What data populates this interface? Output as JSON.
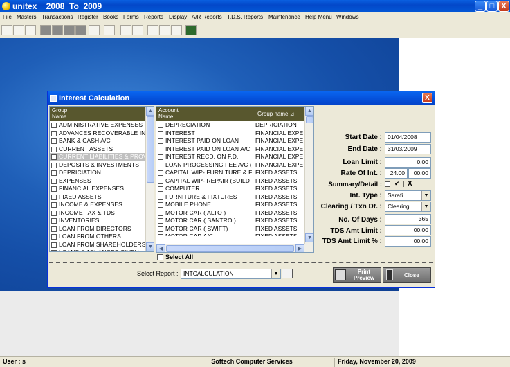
{
  "app": {
    "title": "unitex    2008  To  2009",
    "window_buttons": [
      "_",
      "□",
      "X"
    ]
  },
  "menu": [
    "File",
    "Masters",
    "Transactions",
    "Register",
    "Books",
    "Forms",
    "Reports",
    "Display",
    "A/R Reports",
    "T.D.S. Reports",
    "Maintenance",
    "Help Menu",
    "Windows"
  ],
  "dialog": {
    "title": "Interest Calculation",
    "close": "X",
    "group_grid": {
      "header": "Group\nName",
      "selected_index": 4,
      "rows": [
        "ADMINISTRATIVE EXPENSES",
        "ADVANCES RECOVERABLE IN",
        "BANK & CASH A/C",
        "CURRENT ASSETS",
        "CURRENT LIABILITIES & PROV",
        "DEPOSITS & INVESTMENTS",
        "DEPRICIATION",
        "EXPENSES",
        "FINANCIAL EXPENSES",
        "FIXED ASSETS",
        "INCOME & EXPENSES",
        "INCOME TAX & TDS",
        "INVENTORIES",
        "LOAN FROM DIRECTORS",
        "LOAN FROM OTHERS",
        "LOAN FROM SHAREHOLDERS",
        "LOANS & ADVANCES GIVEN"
      ]
    },
    "account_grid": {
      "header_account": "Account\nName",
      "header_group": "Group name",
      "rows": [
        {
          "account": "DEPRECIATION",
          "group": "DEPRICIATION"
        },
        {
          "account": "INTEREST",
          "group": "FINANCIAL EXPE"
        },
        {
          "account": "INTEREST  PAID ON LOAN",
          "group": "FINANCIAL EXPE"
        },
        {
          "account": "INTEREST PAID ON LOAN A/C",
          "group": "FINANCIAL EXPE"
        },
        {
          "account": "INTEREST RECD. ON F.D.",
          "group": "FINANCIAL EXPE"
        },
        {
          "account": "LOAN PROCESSING FEE A/C (",
          "group": "FINANCIAL EXPE"
        },
        {
          "account": "CAPITAL WIP- FURNITURE & FI",
          "group": "FIXED ASSETS"
        },
        {
          "account": "CAPITAL WIP- REPAIR (BUILD",
          "group": "FIXED ASSETS"
        },
        {
          "account": "COMPUTER",
          "group": "FIXED ASSETS"
        },
        {
          "account": "FURNITURE & FIXTURES",
          "group": "FIXED ASSETS"
        },
        {
          "account": "MOBILE PHONE",
          "group": "FIXED ASSETS"
        },
        {
          "account": "MOTOR CAR ( ALTO )",
          "group": "FIXED ASSETS"
        },
        {
          "account": "MOTOR CAR ( SANTRO )",
          "group": "FIXED ASSETS"
        },
        {
          "account": "MOTOR CAR ( SWIFT)",
          "group": "FIXED ASSETS"
        },
        {
          "account": "MOTOR CAR A/C",
          "group": "FIXED ASSETS"
        },
        {
          "account": "OFFICE EQUIPMENT",
          "group": "FIXED ASSETS"
        }
      ]
    },
    "select_all": "Select All",
    "form": {
      "start_date_label": "Start Date :",
      "start_date": "01/04/2008",
      "end_date_label": "End Date :",
      "end_date": "31/03/2009",
      "loan_limit_label": "Loan Limit :",
      "loan_limit": "0.00",
      "rate_label": "Rate Of Int. :",
      "rate1": "24.00",
      "rate2": "00.00",
      "summary_label": "Summary/Detail :",
      "summary_check": "✔",
      "summary_x": "X",
      "int_type_label": "Int. Type :",
      "int_type": "Sarafi",
      "clearing_label": "Clearing / Txn Dt. :",
      "clearing": "Clearing",
      "days_label": "No. Of Days :",
      "days": "365",
      "tds_limit_label": "TDS Amt Limit :",
      "tds_limit": "00.00",
      "tds_pct_label": "TDS Amt Limit % :",
      "tds_pct": "00.00"
    },
    "select_report_label": "Select Report :",
    "select_report_value": "INTCALCULATION",
    "print_preview": "Print\nPreview",
    "close_button": "Close"
  },
  "status": {
    "user": "User : s",
    "company": "Softech Computer Services",
    "date": "Friday, November 20, 2009"
  },
  "colors": {
    "grid_header": "#58572e",
    "title_blue": "#0552dc"
  }
}
